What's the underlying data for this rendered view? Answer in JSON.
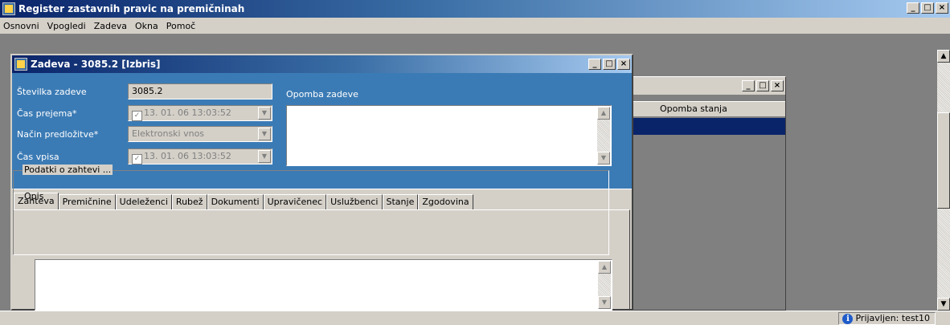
{
  "app": {
    "title": "Register zastavnih pravic na premičninah"
  },
  "menu": [
    "Osnovni",
    "Vpogledi",
    "Zadeva",
    "Okna",
    "Pomoč"
  ],
  "main_window": {
    "title": "Zadeva - 3085.2 [Izbris]",
    "fields": {
      "stevilka_label": "Številka zadeve",
      "stevilka_value": "3085.2",
      "cas_prejema_label": "Čas prejema*",
      "cas_prejema_value": "13. 01. 06 13:03:52",
      "nacin_label": "Način predložitve*",
      "nacin_value": "Elektronski vnos",
      "cas_vpisa_label": "Čas vpisa",
      "cas_vpisa_value": "13. 01. 06 13:03:52",
      "opomba_label": "Opomba zadeve"
    },
    "tabs": [
      "Zahteva",
      "Premičnine",
      "Udeleženci",
      "Rubež",
      "Dokumenti",
      "Upravičenec",
      "Uslužbenci",
      "Stanje",
      "Zgodovina"
    ],
    "active_tab": "Zahteva",
    "group_title": "Podatki o zahtevi ...",
    "opis_label": "Opis"
  },
  "second_window": {
    "column_header": "Opomba stanja"
  },
  "status": {
    "user": "Prijavljen: test10"
  },
  "colors": {
    "title_active": "#0a246a",
    "panel_blue": "#3b7bb5",
    "selection": "#0a246a"
  }
}
